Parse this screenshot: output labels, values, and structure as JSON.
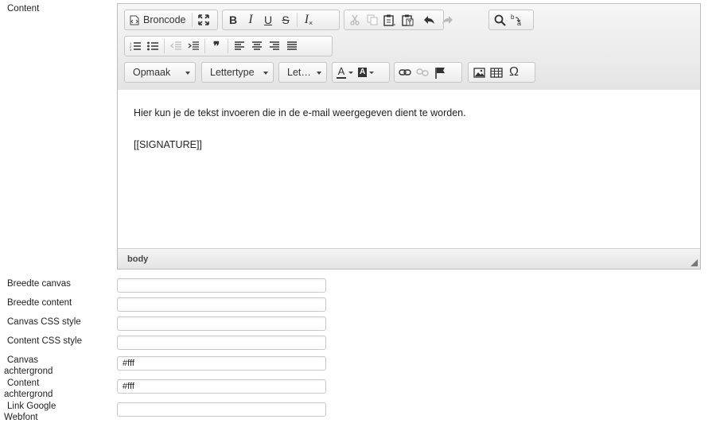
{
  "labels": {
    "content": "Content",
    "breedte_canvas": "Breedte canvas",
    "breedte_content": "Breedte content",
    "canvas_css": "Canvas CSS style",
    "content_css": "Content CSS style",
    "canvas_achtergrond_1": "Canvas",
    "canvas_achtergrond_2": "achtergrond",
    "content_achtergrond_1": "Content",
    "content_achtergrond_2": "achtergrond",
    "link_google_1": "Link Google",
    "link_google_2": "Webfont"
  },
  "toolbar": {
    "source_label": "Broncode",
    "format_combo": "Opmaak",
    "font_combo": "Lettertype",
    "size_combo": "Let…",
    "bold": "B",
    "italic": "I",
    "underline": "U",
    "strike": "S",
    "removeformat": "I",
    "text_color": "A",
    "bg_color": "A",
    "quote": "❞",
    "special_char": "Ω"
  },
  "editor": {
    "line1": "Hier kun je de tekst invoeren die in de e-mail weergegeven dient te worden.",
    "line2": "[[SIGNATURE]]",
    "status_path": "body"
  },
  "fields": {
    "breedte_canvas": "",
    "breedte_content": "",
    "canvas_css": "",
    "content_css": "",
    "canvas_achtergrond": "#fff",
    "content_achtergrond": "#fff",
    "link_google": ""
  }
}
